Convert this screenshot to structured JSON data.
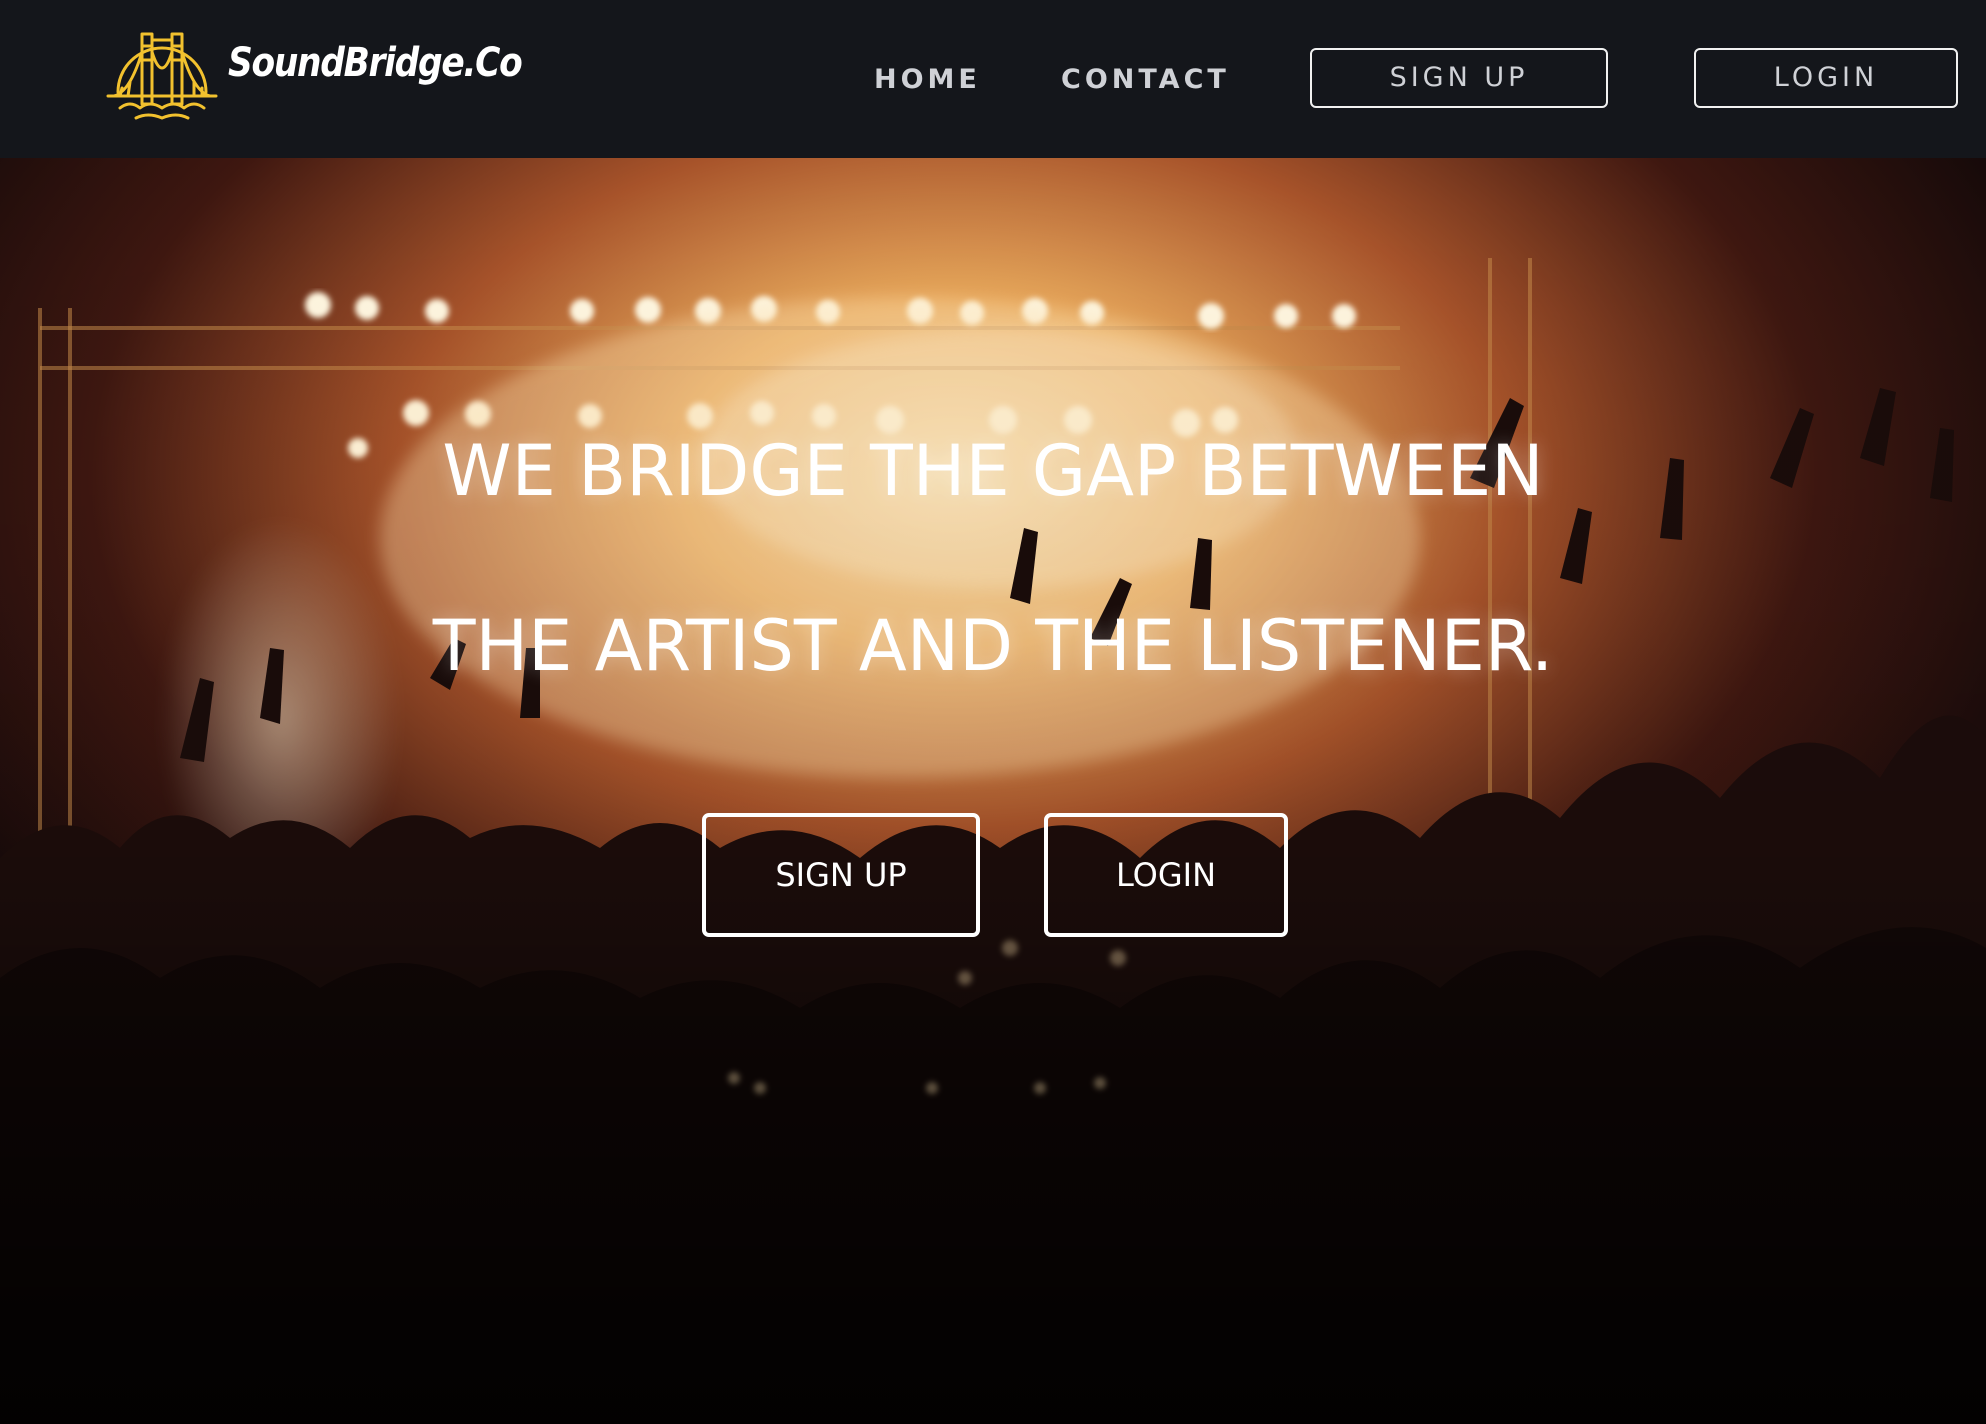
{
  "brand": {
    "name": "SoundBridge.Co",
    "logo_icon": "golden-gate-bridge-icon",
    "logo_color": "#f2c12e"
  },
  "nav": {
    "home_label": "HOME",
    "contact_label": "CONTACT",
    "signup_label": "SIGN UP",
    "login_label": "LOGIN"
  },
  "hero": {
    "background": "concert-crowd-stage-lights-photo",
    "headline_line1": "WE BRIDGE THE GAP BETWEEN",
    "headline_line2": "THE ARTIST AND THE LISTENER.",
    "signup_label": "SIGN UP",
    "login_label": "LOGIN"
  },
  "colors": {
    "navbar_bg": "#14161b",
    "nav_text": "#cfd1d6",
    "hero_text": "#ffffff",
    "stage_glow": "#f0b45c"
  }
}
